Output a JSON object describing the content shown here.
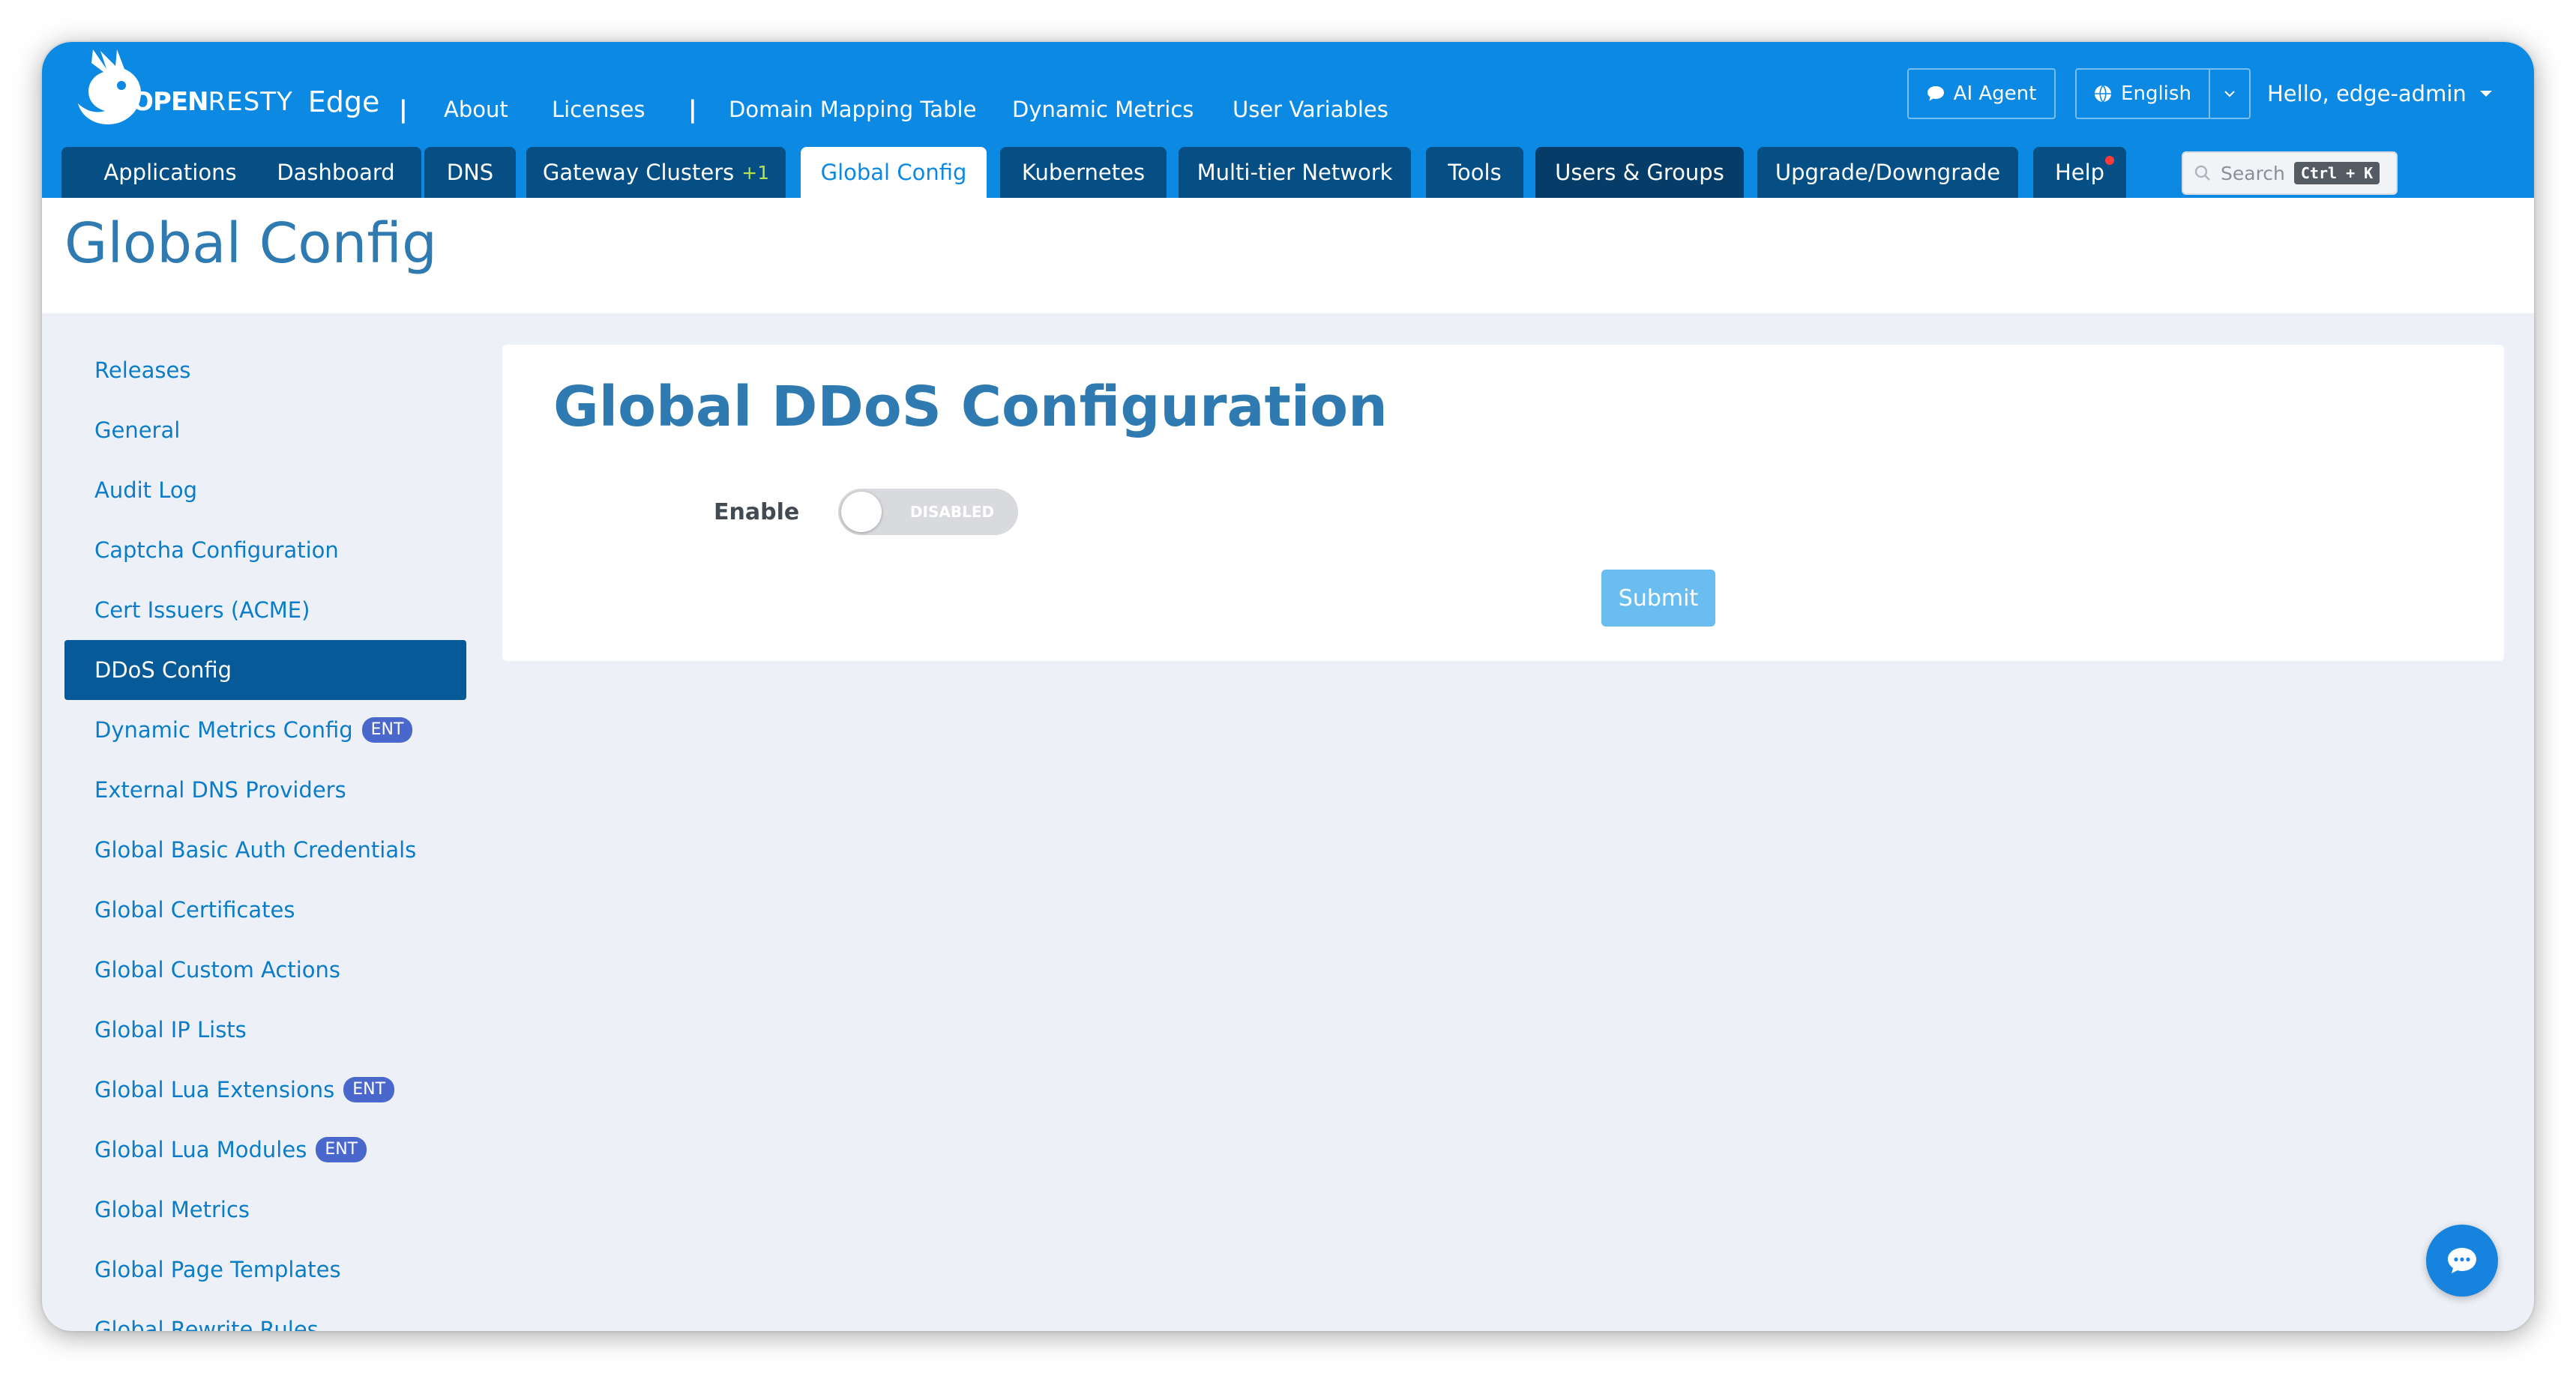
{
  "brand": {
    "open": "OPEN",
    "resty": "RESTY",
    "edge": "Edge"
  },
  "topnav": {
    "about": "About",
    "licenses": "Licenses",
    "domain_mapping": "Domain Mapping Table",
    "dynamic_metrics": "Dynamic Metrics",
    "user_variables": "User Variables",
    "separator": "|"
  },
  "header_right": {
    "ai_agent": "AI Agent",
    "language": "English",
    "user_greeting": "Hello, edge-admin"
  },
  "tabs": [
    {
      "label": "Applications"
    },
    {
      "label": "Dashboard"
    },
    {
      "label": "DNS"
    },
    {
      "label": "Gateway Clusters",
      "suffix": "+1"
    },
    {
      "label": "Global Config",
      "active": true
    },
    {
      "label": "Kubernetes"
    },
    {
      "label": "Multi-tier Network"
    },
    {
      "label": "Tools"
    },
    {
      "label": "Users & Groups"
    },
    {
      "label": "Upgrade/Downgrade"
    },
    {
      "label": "Help",
      "notification_dot": true
    }
  ],
  "search": {
    "placeholder": "Search",
    "shortcut": "Ctrl + K"
  },
  "page_title": "Global Config",
  "sidebar": {
    "badge_text": "ENT",
    "items": [
      {
        "label": "Releases"
      },
      {
        "label": "General"
      },
      {
        "label": "Audit Log"
      },
      {
        "label": "Captcha Configuration"
      },
      {
        "label": "Cert Issuers (ACME)"
      },
      {
        "label": "DDoS Config",
        "active": true
      },
      {
        "label": "Dynamic Metrics Config",
        "badge": "ENT"
      },
      {
        "label": "External DNS Providers"
      },
      {
        "label": "Global Basic Auth Credentials"
      },
      {
        "label": "Global Certificates"
      },
      {
        "label": "Global Custom Actions"
      },
      {
        "label": "Global IP Lists"
      },
      {
        "label": "Global Lua Extensions",
        "badge": "ENT"
      },
      {
        "label": "Global Lua Modules",
        "badge": "ENT"
      },
      {
        "label": "Global Metrics"
      },
      {
        "label": "Global Page Templates"
      },
      {
        "label": "Global Rewrite Rules"
      }
    ]
  },
  "form": {
    "title": "Global DDoS Configuration",
    "enable_label": "Enable",
    "toggle_state": "DISABLED",
    "submit_label": "Submit"
  },
  "icons": {
    "logo": "openresty-bird-logo",
    "ai_agent": "chat-bubble-icon",
    "language": "globe-icon",
    "search": "search-icon",
    "fab": "chat-icon"
  },
  "colors": {
    "header": "#0b89e3",
    "tab": "#064f85",
    "active_sidebar": "#065a97",
    "link": "#0b7dc8",
    "title": "#2f7ab0",
    "badge": "#4a68cc",
    "submit": "#69bdf0"
  }
}
